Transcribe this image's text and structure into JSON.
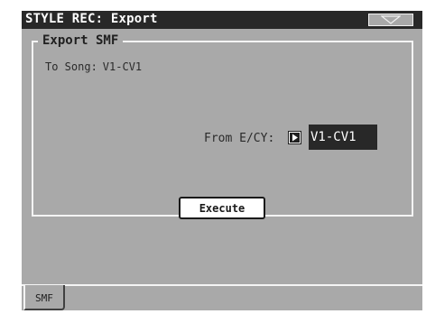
{
  "header": {
    "title": "STYLE REC: Export",
    "menu_icon": "triangle-down-icon"
  },
  "group": {
    "title": "Export SMF"
  },
  "to_song": {
    "label": "To Song:",
    "value": "V1-CV1"
  },
  "from": {
    "label": "From E/CY:",
    "icon": "play-arrow-icon",
    "value": "V1-CV1"
  },
  "actions": {
    "execute_label": "Execute"
  },
  "tabs": [
    {
      "label": "SMF",
      "selected": true
    }
  ],
  "colors": {
    "title_bar": "#282828",
    "panel": "#a9a9a9",
    "highlight": "#f4f4f4"
  }
}
